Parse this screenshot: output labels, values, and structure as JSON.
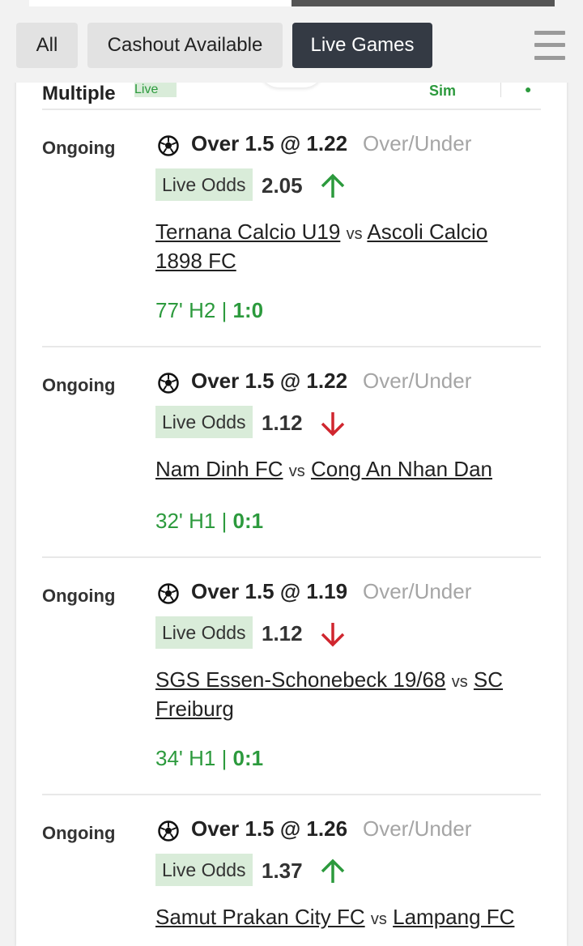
{
  "filters": [
    {
      "label": "All",
      "active": false
    },
    {
      "label": "Cashout Available",
      "active": false
    },
    {
      "label": "Live Games",
      "active": true
    }
  ],
  "peek": {
    "title": "Multiple",
    "badge": "Live",
    "right_text": "Sim"
  },
  "colors": {
    "up": "#2c9a3d",
    "down": "#d0262f",
    "accent_green": "#2c9a3d",
    "active_chip": "#343a44"
  },
  "bets": [
    {
      "status": "Ongoing",
      "selection": "Over 1.5 @ 1.22",
      "market": "Over/Under",
      "odds_label": "Live Odds",
      "odds": "2.05",
      "trend": "up",
      "home": "Ternana Calcio U19",
      "vs": "vs",
      "away": "Ascoli Calcio 1898 FC",
      "time": "77' H2 | ",
      "score": "1:0"
    },
    {
      "status": "Ongoing",
      "selection": "Over 1.5 @ 1.22",
      "market": "Over/Under",
      "odds_label": "Live Odds",
      "odds": "1.12",
      "trend": "down",
      "home": "Nam Dinh FC",
      "vs": "vs",
      "away": "Cong An Nhan Dan",
      "time": "32' H1 | ",
      "score": "0:1"
    },
    {
      "status": "Ongoing",
      "selection": "Over 1.5 @ 1.19",
      "market": "Over/Under",
      "odds_label": "Live Odds",
      "odds": "1.12",
      "trend": "down",
      "home": "SGS Essen-Schonebeck 19/68",
      "vs": "vs",
      "away": "SC Freiburg",
      "time": "34' H1 | ",
      "score": "0:1"
    },
    {
      "status": "Ongoing",
      "selection": "Over 1.5 @ 1.26",
      "market": "Over/Under",
      "odds_label": "Live Odds",
      "odds": "1.37",
      "trend": "up",
      "home": "Samut Prakan City FC",
      "vs": "vs",
      "away": "Lampang FC",
      "time": "",
      "score": ""
    }
  ]
}
